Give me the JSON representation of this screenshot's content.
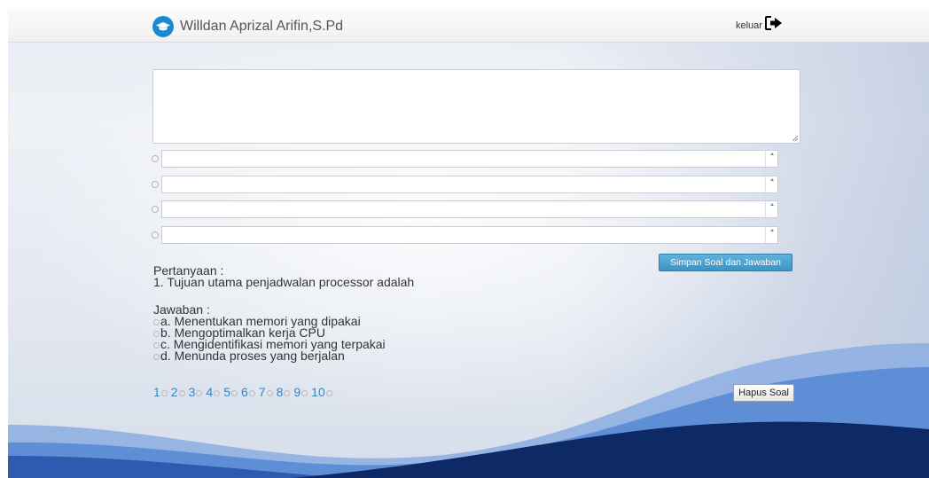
{
  "header": {
    "user_name": "Willdan Aprizal Arifin,S.Pd",
    "logout_label": "keluar",
    "logo_icon": "graduation-cap-icon",
    "logout_icon": "sign-out-icon"
  },
  "form": {
    "question_value": "",
    "options": [
      "",
      "",
      "",
      ""
    ],
    "save_label": "Simpan Soal dan Jawaban"
  },
  "display": {
    "question_heading": "Pertanyaan :",
    "question_text": "1. Tujuan utama penjadwalan processor adalah",
    "answer_heading": "Jawaban :",
    "answers": [
      "a. Menentukan memori yang dipakai",
      "b. Mengoptimalkan kerja CPU",
      "c. Mengidentifikasi memori yang terpakai",
      "d. Menunda proses yang berjalan"
    ]
  },
  "pagination": [
    "1",
    "2",
    "3",
    "4",
    "5",
    "6",
    "7",
    "8",
    "9",
    "10"
  ],
  "delete_label": "Hapus Soal",
  "colors": {
    "accent_blue": "#3a93c7",
    "link_blue": "#2f88c7",
    "wave_dark": "#0e2a66",
    "wave_light": "#5e8fd6"
  }
}
